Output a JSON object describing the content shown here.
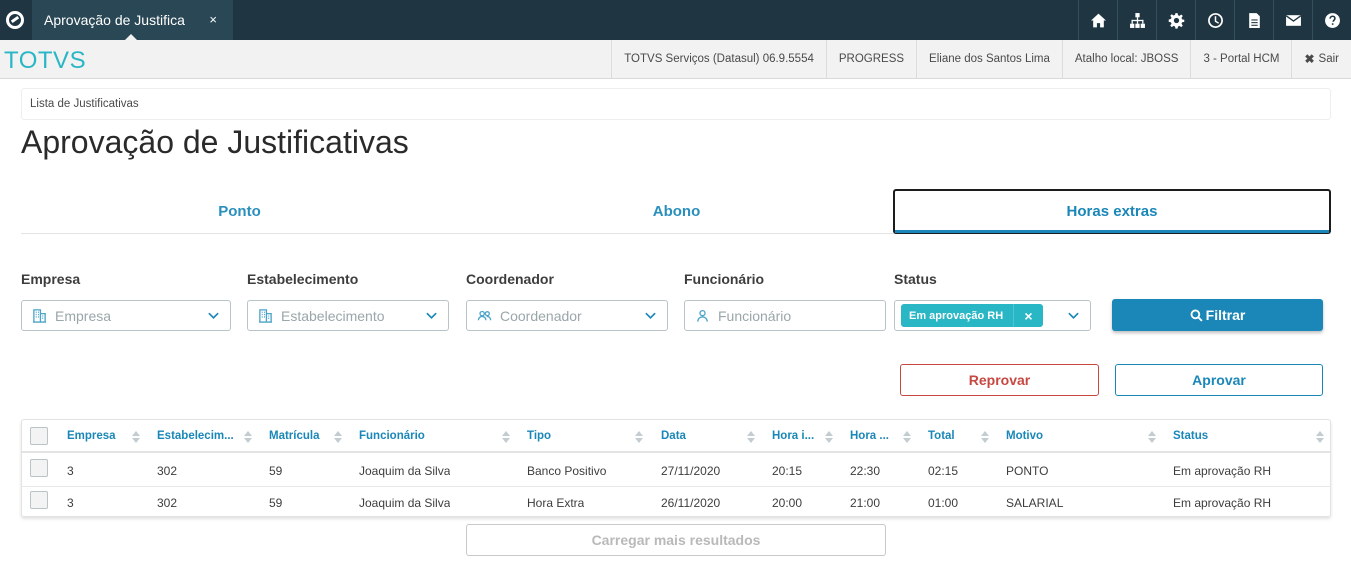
{
  "topbar": {
    "tab_title": "Aprovação de Justifica",
    "tab_close": "×",
    "icons": [
      "home-icon",
      "sitemap-icon",
      "gear-icon",
      "clock-icon",
      "document-icon",
      "mail-icon",
      "help-icon"
    ]
  },
  "header": {
    "brand": "TOTVS",
    "info": [
      "TOTVS Serviços (Datasul) 06.9.5554",
      "PROGRESS",
      "Eliane dos Santos Lima",
      "Atalho local: JBOSS",
      "3 - Portal HCM"
    ],
    "exit_icon": "✖",
    "exit_label": "Sair"
  },
  "breadcrumb": "Lista de Justificativas",
  "page_title": "Aprovação de Justificativas",
  "tabs": [
    "Ponto",
    "Abono",
    "Horas extras"
  ],
  "active_tab": "Horas extras",
  "filters": {
    "empresa": {
      "label": "Empresa",
      "placeholder": "Empresa"
    },
    "estabelecimento": {
      "label": "Estabelecimento",
      "placeholder": "Estabelecimento"
    },
    "coordenador": {
      "label": "Coordenador",
      "placeholder": "Coordenador"
    },
    "funcionario": {
      "label": "Funcionário",
      "placeholder": "Funcionário"
    },
    "status": {
      "label": "Status",
      "chip": "Em aprovação RH",
      "chip_remove": "×"
    }
  },
  "buttons": {
    "filter": "Filtrar",
    "reject": "Reprovar",
    "approve": "Aprovar",
    "load_more": "Carregar mais resultados"
  },
  "table": {
    "columns": [
      "Empresa",
      "Estabelecim...",
      "Matrícula",
      "Funcionário",
      "Tipo",
      "Data",
      "Hora i...",
      "Hora ...",
      "Total",
      "Motivo",
      "Status"
    ],
    "rows": [
      [
        "3",
        "302",
        "59",
        "Joaquim da Silva",
        "Banco Positivo",
        "27/11/2020",
        "20:15",
        "22:30",
        "02:15",
        "PONTO",
        "Em aprovação RH"
      ],
      [
        "3",
        "302",
        "59",
        "Joaquim da Silva",
        "Hora Extra",
        "26/11/2020",
        "20:00",
        "21:00",
        "01:00",
        "SALARIAL",
        "Em aprovação RH"
      ]
    ]
  },
  "colors": {
    "topbar": "#1f3642",
    "brand": "#29b6c5",
    "primary": "#1a87b8",
    "danger": "#c64841"
  }
}
